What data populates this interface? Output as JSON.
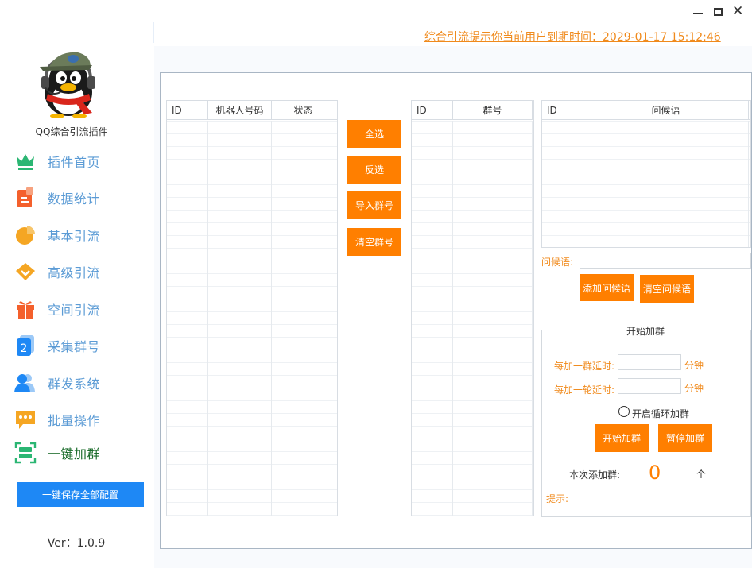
{
  "window": {
    "minimize_glyph": "",
    "close_glyph": "✕"
  },
  "sidebar": {
    "app_name": "QQ综合引流插件",
    "items": [
      {
        "label": "插件首页",
        "icon": "crown-icon",
        "color": "#2bb673"
      },
      {
        "label": "数据统计",
        "icon": "clipboard-icon",
        "color": "#f4602c"
      },
      {
        "label": "基本引流",
        "icon": "pie-icon",
        "color": "#f5a623"
      },
      {
        "label": "高级引流",
        "icon": "diamond-icon",
        "color": "#f5a623"
      },
      {
        "label": "空间引流",
        "icon": "gift-icon",
        "color": "#f4602c"
      },
      {
        "label": "采集群号",
        "icon": "number-two-icon",
        "color": "#1e88f5"
      },
      {
        "label": "群发系统",
        "icon": "users-icon",
        "color": "#1e88f5"
      },
      {
        "label": "批量操作",
        "icon": "chat-icon",
        "color": "#f5a623"
      },
      {
        "label": "一键加群",
        "icon": "scan-icon",
        "color": "#2bb673"
      }
    ],
    "icon_glyphs": {
      "number_two": "2"
    },
    "save_all_label": "一键保存全部配置",
    "version": "Ver：1.0.9"
  },
  "header": {
    "expire_notice": "综合引流提示你当前用户到期时间：2029-01-17 15:12:46"
  },
  "robots_table": {
    "columns": [
      "ID",
      "机器人号码",
      "状态"
    ],
    "rows": []
  },
  "middle_buttons": {
    "select_all": "全选",
    "invert": "反选",
    "import_groups": "导入群号",
    "clear_groups": "清空群号"
  },
  "groups_table": {
    "columns": [
      "ID",
      "群号"
    ],
    "rows": []
  },
  "greetings_table": {
    "columns": [
      "ID",
      "问候语"
    ],
    "rows": []
  },
  "greeting_form": {
    "label": "问候语:",
    "value": "",
    "add_label": "添加问候语",
    "clear_label": "清空问候语"
  },
  "join_group": {
    "title": "开始加群",
    "delay_per_group_label": "每加一群延时:",
    "delay_per_group_value": "",
    "delay_per_round_label": "每加一轮延时:",
    "delay_per_round_value": "",
    "unit": "分钟",
    "loop_label": "开启循环加群",
    "loop_checked": false,
    "start_label": "开始加群",
    "pause_label": "暂停加群",
    "added_label": "本次添加群:",
    "added_count": "0",
    "added_unit": "个",
    "hint_label": "提示:"
  }
}
